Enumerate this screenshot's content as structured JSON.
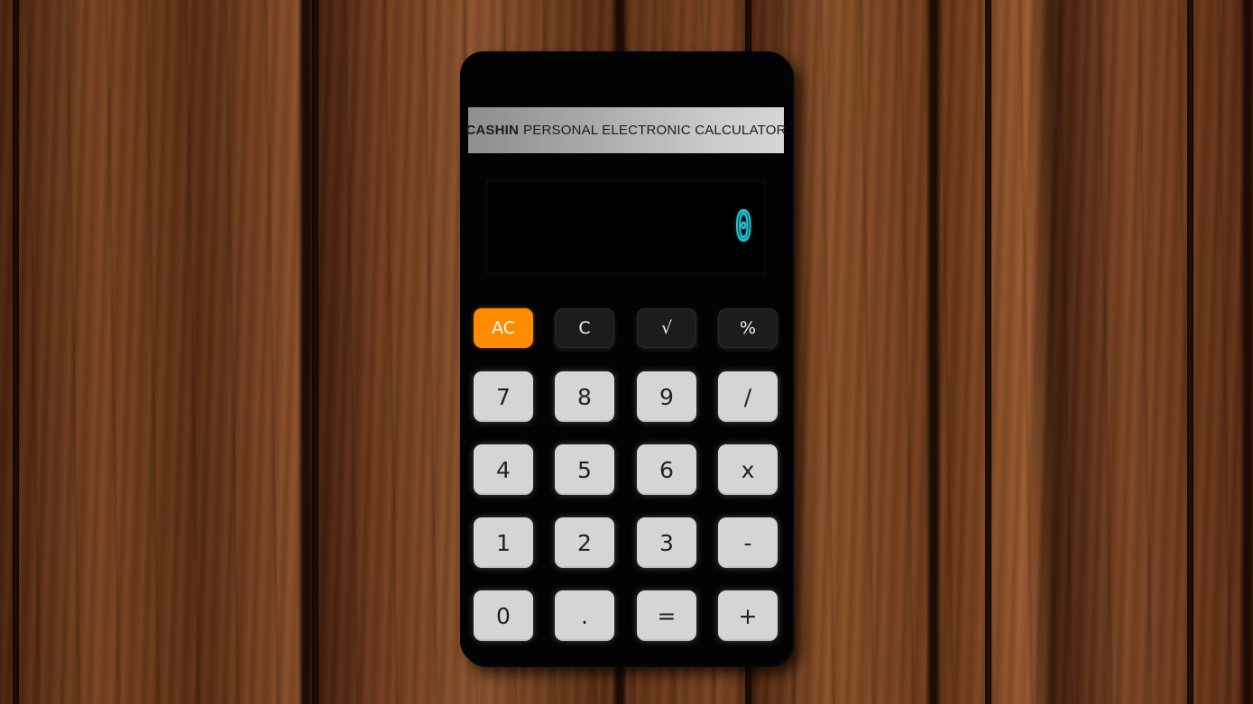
{
  "calculator": {
    "brand": {
      "name": "CASHIN",
      "tagline": "PERSONAL ELECTRONIC CALCULATOR"
    },
    "display": {
      "value": "0"
    },
    "function_keys": [
      {
        "label": "AC"
      },
      {
        "label": "C"
      },
      {
        "label": "√"
      },
      {
        "label": "%"
      }
    ],
    "keys": [
      {
        "label": "7"
      },
      {
        "label": "8"
      },
      {
        "label": "9"
      },
      {
        "label": "/"
      },
      {
        "label": "4"
      },
      {
        "label": "5"
      },
      {
        "label": "6"
      },
      {
        "label": "x"
      },
      {
        "label": "1"
      },
      {
        "label": "2"
      },
      {
        "label": "3"
      },
      {
        "label": "-"
      },
      {
        "label": "0"
      },
      {
        "label": "."
      },
      {
        "label": "="
      },
      {
        "label": "+"
      }
    ]
  },
  "colors": {
    "accent": "#ff8c00",
    "display_digits": "#22c4d6",
    "body": "#030303",
    "key_face": "#d5d5d5"
  }
}
